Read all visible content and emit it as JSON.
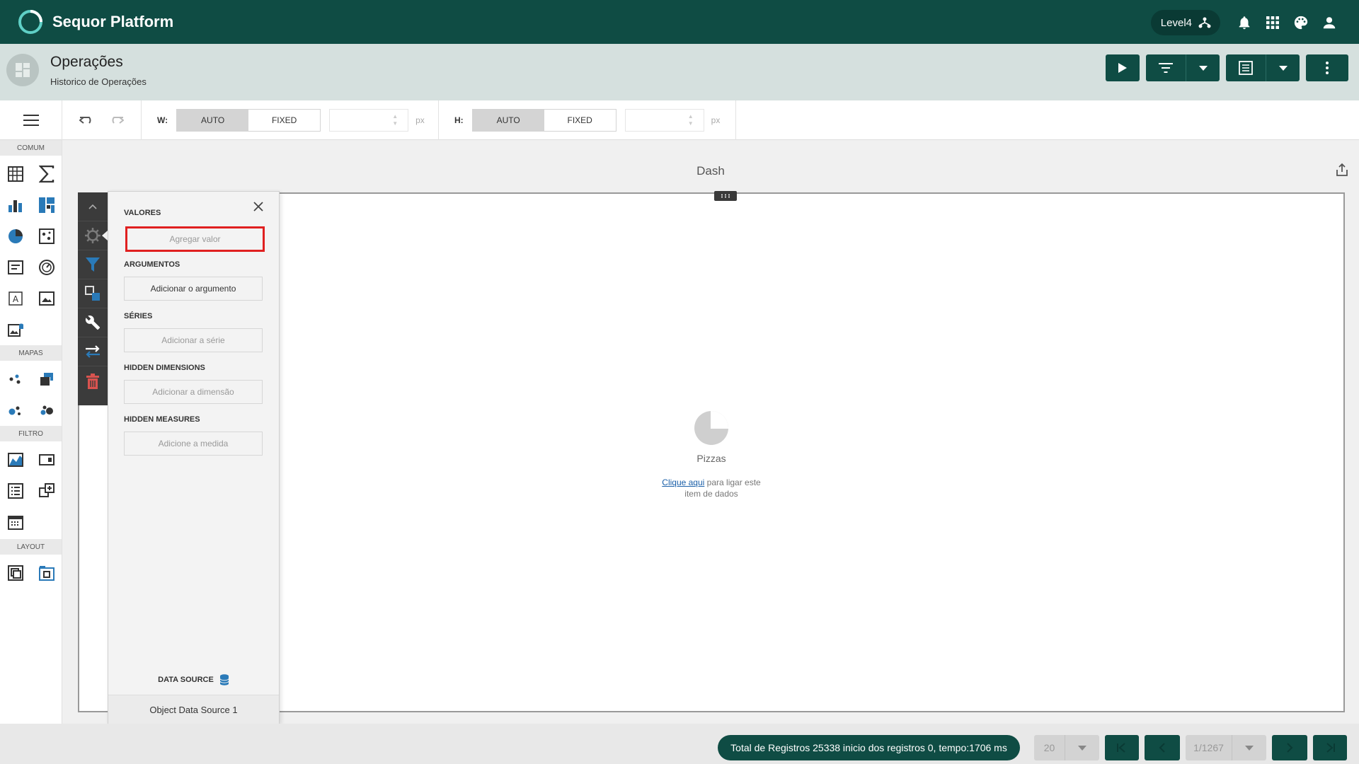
{
  "app": {
    "title": "Sequor Platform"
  },
  "topbar": {
    "level": "Level4"
  },
  "page": {
    "title": "Operações",
    "subtitle": "Historico de Operações"
  },
  "toolbar": {
    "width": {
      "label": "W:",
      "auto": "AUTO",
      "fixed": "FIXED",
      "unit": "px"
    },
    "height": {
      "label": "H:",
      "auto": "AUTO",
      "fixed": "FIXED",
      "unit": "px"
    }
  },
  "palette": {
    "sections": [
      "COMUM",
      "MAPAS",
      "FILTRO",
      "LAYOUT"
    ]
  },
  "dashboard": {
    "title": "Dash",
    "empty": {
      "title": "Pizzas",
      "link": "Clique aqui",
      "hint_rest": "para ligar este",
      "hint_line2": "item de dados"
    }
  },
  "binding": {
    "values_header": "VALORES",
    "values_placeholder": "Agregar valor",
    "arguments_header": "ARGUMENTOS",
    "arguments_button": "Adicionar o argumento",
    "series_header": "SÉRIES",
    "series_placeholder": "Adicionar a série",
    "hidden_dimensions_header": "HIDDEN DIMENSIONS",
    "hidden_dimensions_placeholder": "Adicionar a dimensão",
    "hidden_measures_header": "HIDDEN MEASURES",
    "hidden_measures_placeholder": "Adicione a medida",
    "data_source_header": "DATA SOURCE",
    "data_source_value": "Object Data Source 1"
  },
  "footer": {
    "status": "Total de Registros 25338 inicio dos registros 0, tempo:1706 ms",
    "page_size": "20",
    "page_indicator": "1/1267"
  },
  "colors": {
    "primary": "#0f4c44",
    "titleband": "#d5e0de",
    "accent_blue": "#2a7ab8",
    "delete_red": "#d9534f",
    "highlight_red": "#e02020"
  }
}
